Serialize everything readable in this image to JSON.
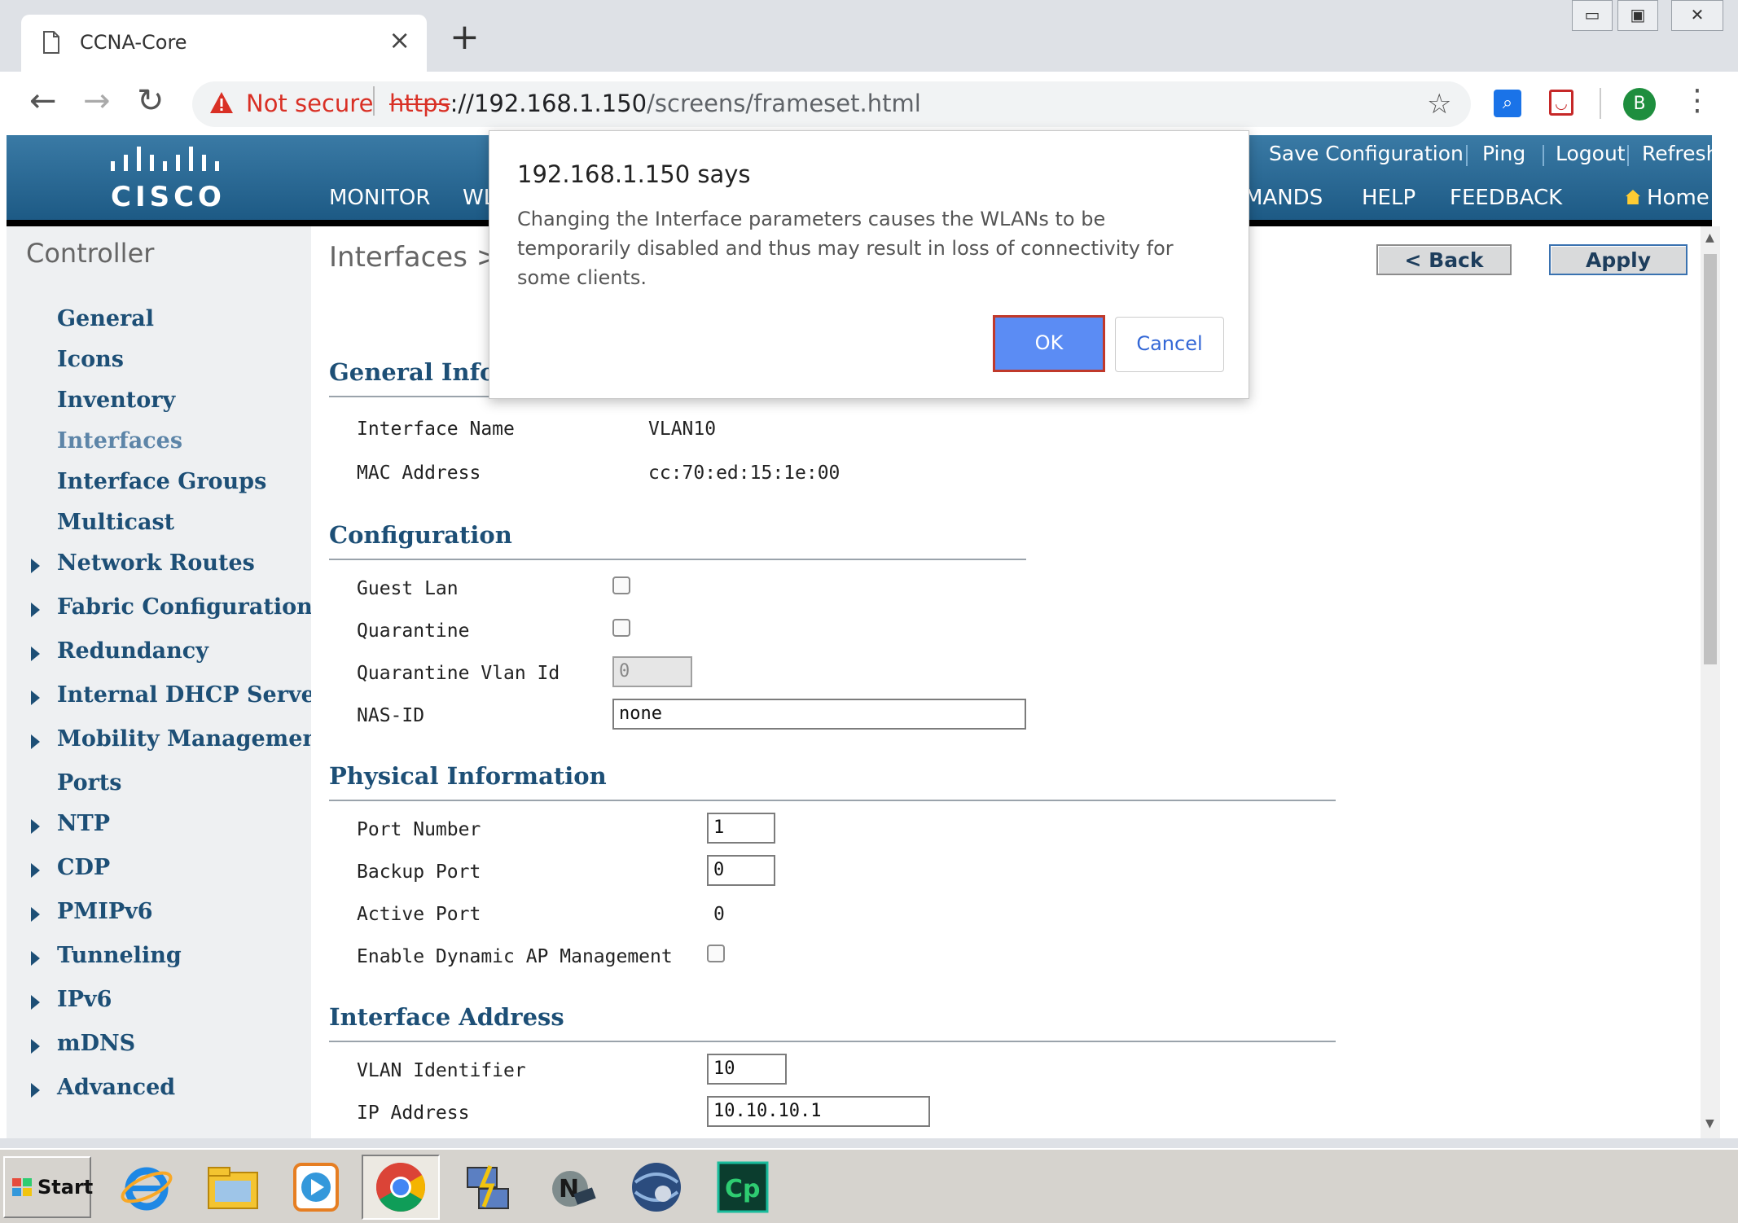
{
  "browser": {
    "tab_title": "CCNA-Core",
    "not_secure": "Not secure",
    "url_scheme": "https",
    "url_host": "://192.168.1.150",
    "url_path": "/screens/frameset.html",
    "avatar_letter": "B"
  },
  "header": {
    "brand": "CISCO",
    "nav": [
      "MONITOR",
      "WL",
      "MANDS",
      "HELP",
      "FEEDBACK"
    ],
    "utility": [
      "Save Configuration",
      "Ping",
      "Logout",
      "Refresh"
    ],
    "home": "Home"
  },
  "sidebar": {
    "title": "Controller",
    "items": [
      {
        "label": "General",
        "expandable": false
      },
      {
        "label": "Icons",
        "expandable": false
      },
      {
        "label": "Inventory",
        "expandable": false
      },
      {
        "label": "Interfaces",
        "expandable": false,
        "active": true
      },
      {
        "label": "Interface Groups",
        "expandable": false
      },
      {
        "label": "Multicast",
        "expandable": false
      },
      {
        "label": "Network Routes",
        "expandable": true
      },
      {
        "label": "Fabric Configuration",
        "expandable": true
      },
      {
        "label": "Redundancy",
        "expandable": true
      },
      {
        "label": "Internal DHCP Server",
        "expandable": true
      },
      {
        "label": "Mobility Management",
        "expandable": true
      },
      {
        "label": "Ports",
        "expandable": false
      },
      {
        "label": "NTP",
        "expandable": true
      },
      {
        "label": "CDP",
        "expandable": true
      },
      {
        "label": "PMIPv6",
        "expandable": true
      },
      {
        "label": "Tunneling",
        "expandable": true
      },
      {
        "label": "IPv6",
        "expandable": true
      },
      {
        "label": "mDNS",
        "expandable": true
      },
      {
        "label": "Advanced",
        "expandable": true
      }
    ]
  },
  "content": {
    "breadcrumb": "Interfaces >",
    "back_label": "< Back",
    "apply_label": "Apply",
    "general_info": {
      "title": "General Info",
      "interface_name_label": "Interface Name",
      "interface_name": "VLAN10",
      "mac_label": "MAC Address",
      "mac": "cc:70:ed:15:1e:00"
    },
    "configuration": {
      "title": "Configuration",
      "guest_lan_label": "Guest Lan",
      "quarantine_label": "Quarantine",
      "quarantine_vlan_label": "Quarantine Vlan Id",
      "quarantine_vlan": "0",
      "nas_id_label": "NAS-ID",
      "nas_id": "none"
    },
    "physical": {
      "title": "Physical Information",
      "port_number_label": "Port Number",
      "port_number": "1",
      "backup_port_label": "Backup Port",
      "backup_port": "0",
      "active_port_label": "Active Port",
      "active_port": "0",
      "dynamic_ap_label": "Enable Dynamic AP Management"
    },
    "address": {
      "title": "Interface Address",
      "vlan_id_label": "VLAN Identifier",
      "vlan_id": "10",
      "ip_label": "IP Address",
      "ip": "10.10.10.1"
    }
  },
  "dialog": {
    "title": "192.168.1.150 says",
    "message": "Changing the Interface parameters causes the WLANs to be temporarily disabled and thus may result in loss of connectivity for some clients.",
    "ok": "OK",
    "cancel": "Cancel"
  },
  "taskbar": {
    "start": "Start",
    "apps": [
      "internet-explorer-icon",
      "file-explorer-icon",
      "media-player-icon",
      "chrome-icon",
      "network-tool-icon",
      "network-n-icon",
      "globe-app-icon",
      "captivate-icon"
    ]
  },
  "colors": {
    "header_top": "#3a7aa5",
    "header_bottom": "#1d5a85",
    "nav_link": "#1d4f76",
    "dialog_ok": "#5b8cf4",
    "focus_ring": "#c0392b"
  }
}
